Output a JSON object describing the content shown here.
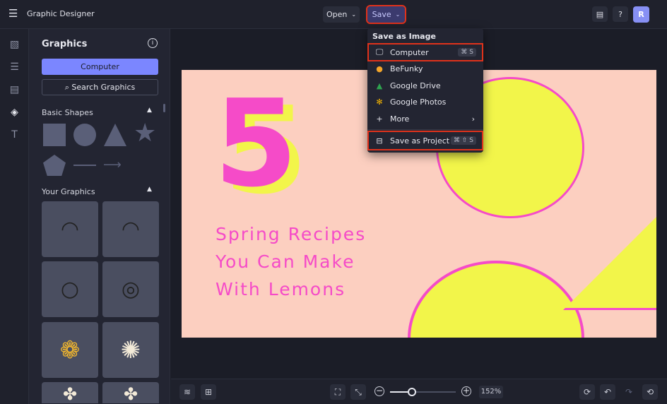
{
  "header": {
    "app_title": "Graphic Designer",
    "open_label": "Open",
    "save_label": "Save",
    "avatar_initial": "R"
  },
  "save_menu": {
    "heading": "Save as Image",
    "items": [
      {
        "label": "Computer",
        "icon": "monitor-icon",
        "shortcut": "⌘ S"
      },
      {
        "label": "BeFunky",
        "icon": "befunky-icon"
      },
      {
        "label": "Google Drive",
        "icon": "google-drive-icon"
      },
      {
        "label": "Google Photos",
        "icon": "google-photos-icon"
      },
      {
        "label": "More",
        "icon": "plus-icon"
      }
    ],
    "project": {
      "label": "Save as Project",
      "shortcut": "⌘ ⇧ S"
    }
  },
  "panel": {
    "title": "Graphics",
    "computer_label": "Computer",
    "search_label": "Search Graphics",
    "basic_shapes": "Basic Shapes",
    "your_graphics": "Your Graphics"
  },
  "canvas": {
    "number": "5",
    "lines": [
      "Spring Recipes",
      "You Can Make",
      "With Lemons"
    ]
  },
  "bottom": {
    "zoom": "152%",
    "zoom_fraction": 0.33
  },
  "colors": {
    "accent": "#7b86ff",
    "highlight": "#e0321b",
    "pink": "#f54bc8",
    "yellow": "#f2f54a",
    "bg": "#fccfc0"
  }
}
